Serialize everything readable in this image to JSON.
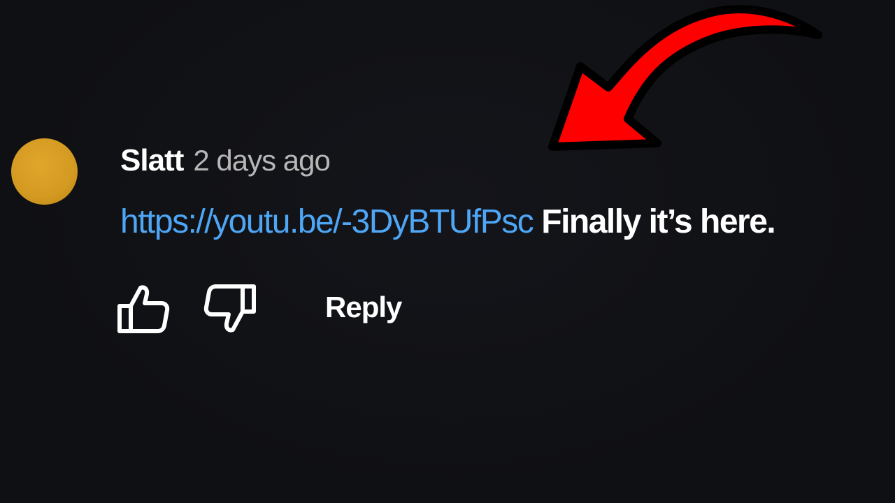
{
  "comment": {
    "author": "Slatt",
    "timestamp": "2 days ago",
    "link_text": "https://youtu.be/-3DyBTUfPsc",
    "body_text": "Finally it’s here.",
    "avatar_color": "#D39A22"
  },
  "actions": {
    "like_icon": "thumbs-up-icon",
    "dislike_icon": "thumbs-down-icon",
    "reply_label": "Reply"
  },
  "overlay": {
    "arrow_icon": "curved-arrow-icon",
    "arrow_color": "#FF0000"
  }
}
